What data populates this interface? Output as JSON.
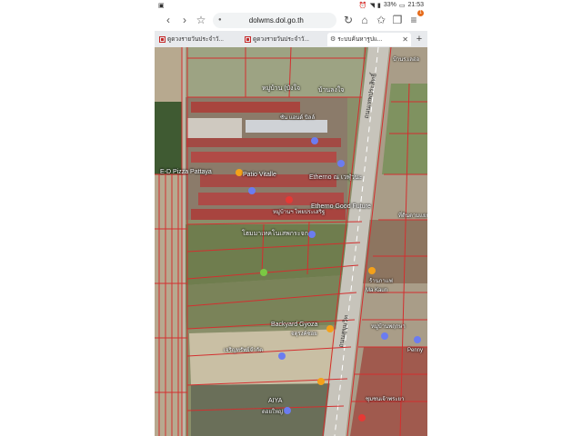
{
  "status_bar": {
    "battery": "33%",
    "time": "21:53"
  },
  "browser": {
    "url": "dolwms.dol.go.th",
    "tabs_badge": "1",
    "tabs": [
      {
        "label": "ดูดวงรายวันประจำวั...",
        "active": false
      },
      {
        "label": "ดูดวงรายวันประจำวั...",
        "active": false
      },
      {
        "label": "ระบบค้นหารูปแ...",
        "active": true
      }
    ],
    "new_tab_label": "+"
  },
  "map": {
    "labels": [
      {
        "text": "บ้านร.เลอ่อ",
        "kind": "place"
      },
      {
        "text": "หมู่บ้าน (บังใจ",
        "kind": "place"
      },
      {
        "text": "บ้านลงใจ",
        "kind": "place"
      },
      {
        "text": "ซัน แอนด์ บิลล์",
        "kind": "place"
      },
      {
        "text": "E-D Pizza Pattaya",
        "kind": "poi"
      },
      {
        "text": "Patio Vitalle",
        "kind": "poi"
      },
      {
        "text": "Etherno ณ เวฬุวนะ",
        "kind": "poi"
      },
      {
        "text": "หมู่บ้านฯ ไทยประเสริฐ",
        "kind": "place"
      },
      {
        "text": "Etherno Good Future",
        "kind": "poi"
      },
      {
        "text": "ที่ดินตามแยก",
        "kind": "place"
      },
      {
        "text": "โฮมมาเทคโนเสพกระจก",
        "kind": "poi"
      },
      {
        "text": "ร้านกาแฟ",
        "kind": "poi"
      },
      {
        "text": "Ma Kaun",
        "kind": "poi"
      },
      {
        "text": "หมู่บ้านพฤกษา",
        "kind": "place"
      },
      {
        "text": "Backyard Gyoza",
        "kind": "poi"
      },
      {
        "text": "จตุรงค์ซอย",
        "kind": "place"
      },
      {
        "text": "เจริญทรัพย์จำกัด",
        "kind": "poi"
      },
      {
        "text": "Penny",
        "kind": "poi"
      },
      {
        "text": "AIYA",
        "kind": "poi"
      },
      {
        "text": "ดอยใหญ่",
        "kind": "place"
      },
      {
        "text": "ชุมชนเจ้าพระยา",
        "kind": "place"
      },
      {
        "text": "ถนนเทพประสิทธิ์",
        "kind": "road"
      },
      {
        "text": "ถนนสุขุมวิท",
        "kind": "road"
      }
    ]
  },
  "colors": {
    "parcel_line": "#d32f2f",
    "pin_red": "#e53935",
    "pin_orange": "#f4a11a",
    "pin_blue": "#6b7cf0",
    "pin_green": "#7ac943",
    "vegetation": "#4f6b37"
  }
}
